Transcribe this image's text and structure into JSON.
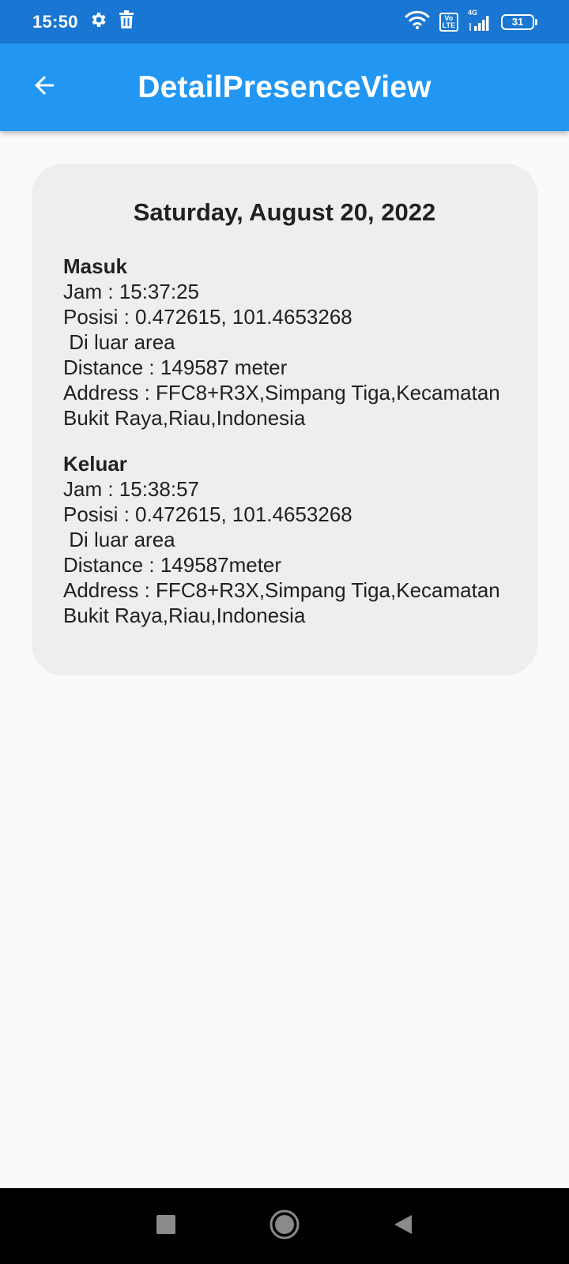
{
  "status_bar": {
    "time": "15:50",
    "volte_top": "Vo",
    "volte_bottom": "LTE",
    "network": "4G",
    "battery": "31"
  },
  "app_bar": {
    "title": "DetailPresenceView"
  },
  "card": {
    "date": "Saturday, August 20, 2022",
    "masuk": {
      "title": "Masuk",
      "jam": "Jam : 15:37:25",
      "posisi": "Posisi : 0.472615, 101.4653268",
      "area": " Di luar area",
      "distance": "Distance : 149587 meter",
      "address": "Address : FFC8+R3X,Simpang Tiga,Kecamatan Bukit Raya,Riau,Indonesia"
    },
    "keluar": {
      "title": "Keluar",
      "jam": "Jam : 15:38:57",
      "posisi": "Posisi : 0.472615, 101.4653268",
      "area": " Di luar area",
      "distance": "Distance : 149587meter",
      "address": "Address : FFC8+R3X,Simpang Tiga,Kecamatan Bukit Raya,Riau,Indonesia"
    }
  },
  "colors": {
    "status_bar": "#1976d2",
    "app_bar": "#2196f3",
    "card": "#eeeeee",
    "background": "#fafafa",
    "nav_bar": "#000000"
  },
  "icons": {
    "status_left": [
      "gear-icon",
      "trash-icon"
    ],
    "status_right": [
      "wifi-icon",
      "volte-icon",
      "signal-icon",
      "battery-icon"
    ],
    "app_bar": [
      "back-arrow-icon"
    ],
    "nav_bar": [
      "recents-square-icon",
      "home-circle-icon",
      "back-triangle-icon"
    ]
  }
}
